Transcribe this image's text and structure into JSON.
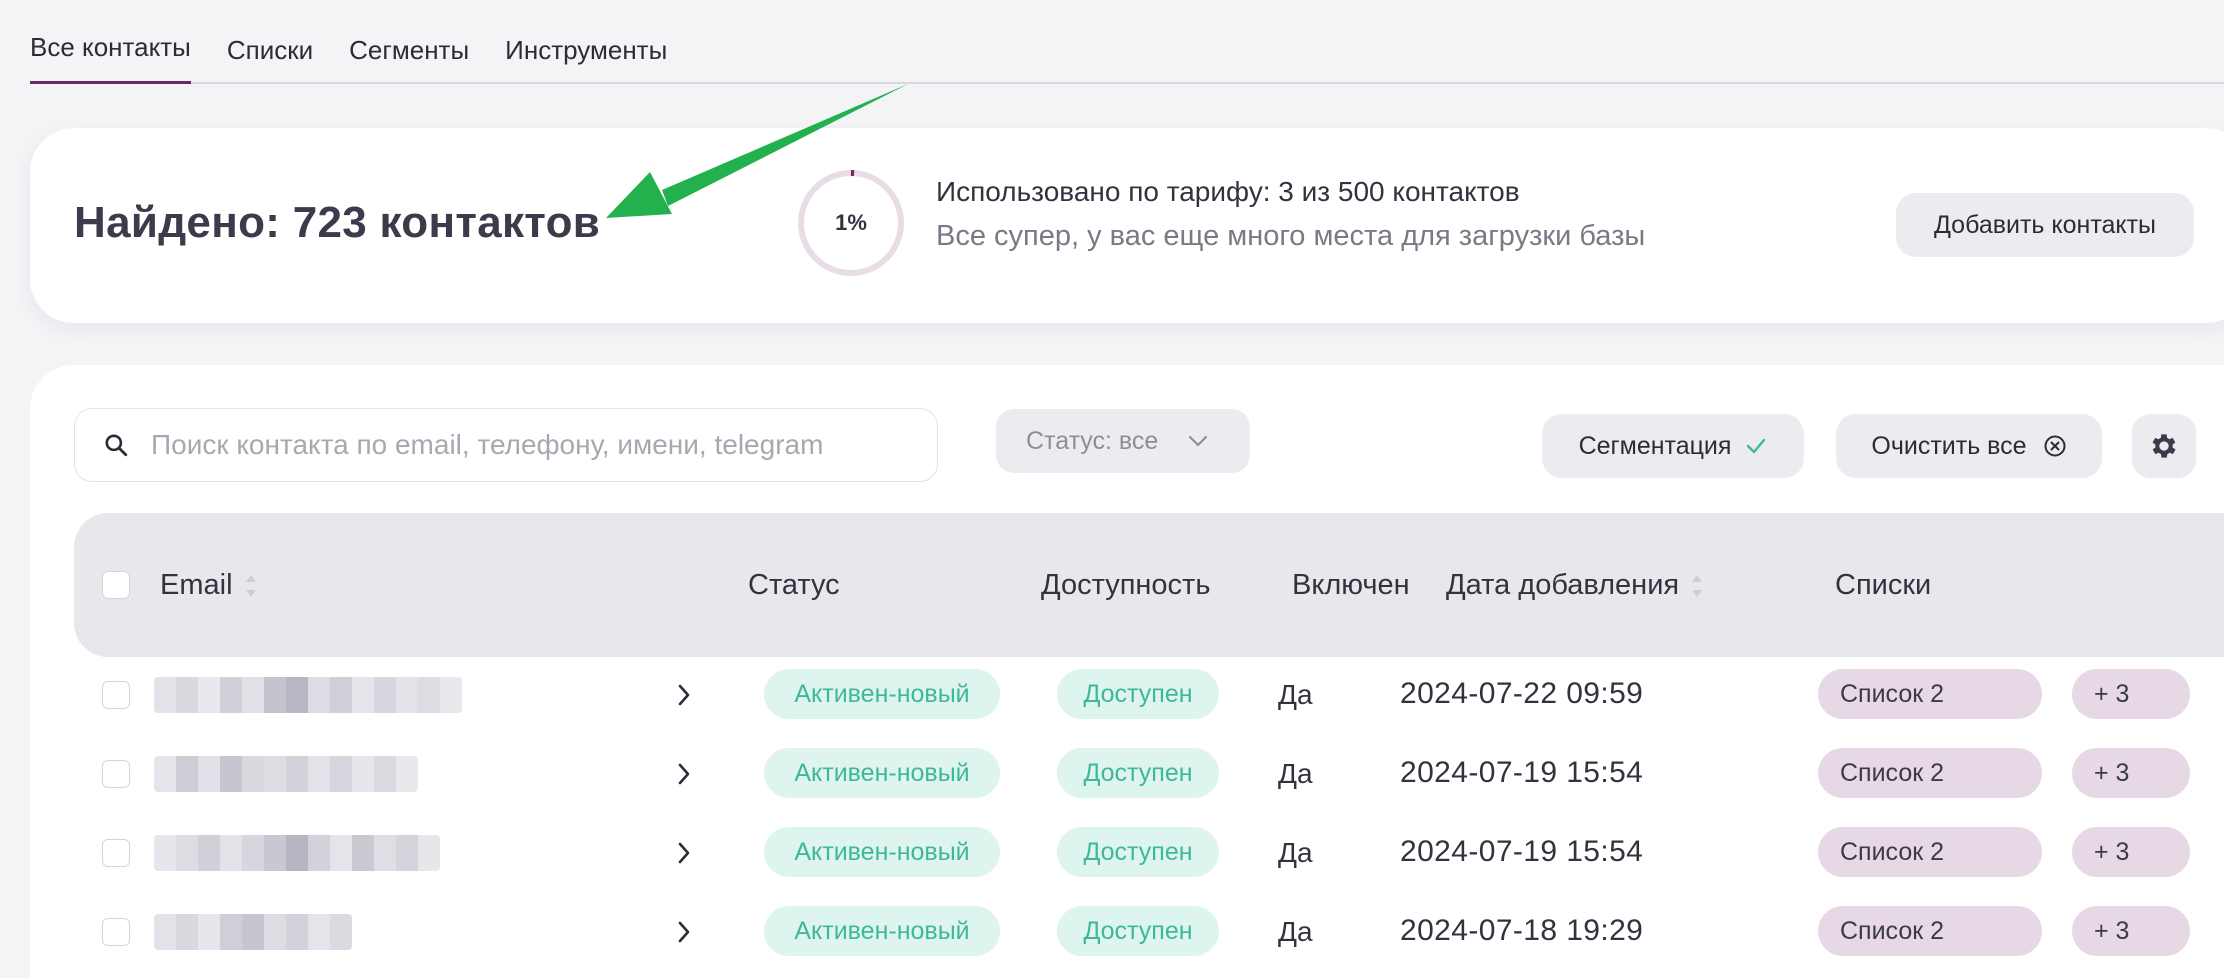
{
  "tabs": [
    {
      "label": "Все контакты",
      "active": true
    },
    {
      "label": "Списки",
      "active": false
    },
    {
      "label": "Сегменты",
      "active": false
    },
    {
      "label": "Инструменты",
      "active": false
    }
  ],
  "summary": {
    "found": "Найдено: 723 контактов",
    "usage_percent_label": "1%",
    "usage_fraction": 0.01,
    "quota_title": "Использовано по тарифу: 3 из 500 контактов",
    "quota_subtitle": "Все супер, у вас еще много места для загрузки базы",
    "add_button": "Добавить контакты"
  },
  "toolbar": {
    "search_placeholder": "Поиск контакта по email, телефону, имени, telegram",
    "status_filter": "Статус: все",
    "segmentation_button": "Сегментация",
    "clear_button": "Очистить все"
  },
  "table": {
    "headers": {
      "email": "Email",
      "status": "Статус",
      "availability": "Доступность",
      "enabled": "Включен",
      "date_added": "Дата добавления",
      "lists": "Списки"
    },
    "rows": [
      {
        "email": "",
        "status": "Активен-новый",
        "availability": "Доступен",
        "enabled": "Да",
        "date": "2024-07-22 09:59",
        "list": "Список 2",
        "more": "+ 3"
      },
      {
        "email": "",
        "status": "Активен-новый",
        "availability": "Доступен",
        "enabled": "Да",
        "date": "2024-07-19 15:54",
        "list": "Список 2",
        "more": "+ 3"
      },
      {
        "email": "",
        "status": "Активен-новый",
        "availability": "Доступен",
        "enabled": "Да",
        "date": "2024-07-19 15:54",
        "list": "Список 2",
        "more": "+ 3"
      },
      {
        "email": "",
        "status": "Активен-новый",
        "availability": "Доступен",
        "enabled": "Да",
        "date": "2024-07-18 19:29",
        "list": "Список 2",
        "more": "+ 3"
      }
    ]
  },
  "colors": {
    "accent": "#6b2a63",
    "status_green_bg": "#def4ee",
    "status_green_text": "#3fb899",
    "list_pill_bg": "#e6d9e5",
    "annotation_arrow": "#22b14c"
  },
  "icons": {
    "search": "search-icon",
    "status_chevron": "chevron-down-icon",
    "segmentation": "check-icon",
    "clear": "close-circle-icon",
    "settings": "gear-icon",
    "row_expand": "chevron-right-icon",
    "sort": "sort-icon"
  }
}
